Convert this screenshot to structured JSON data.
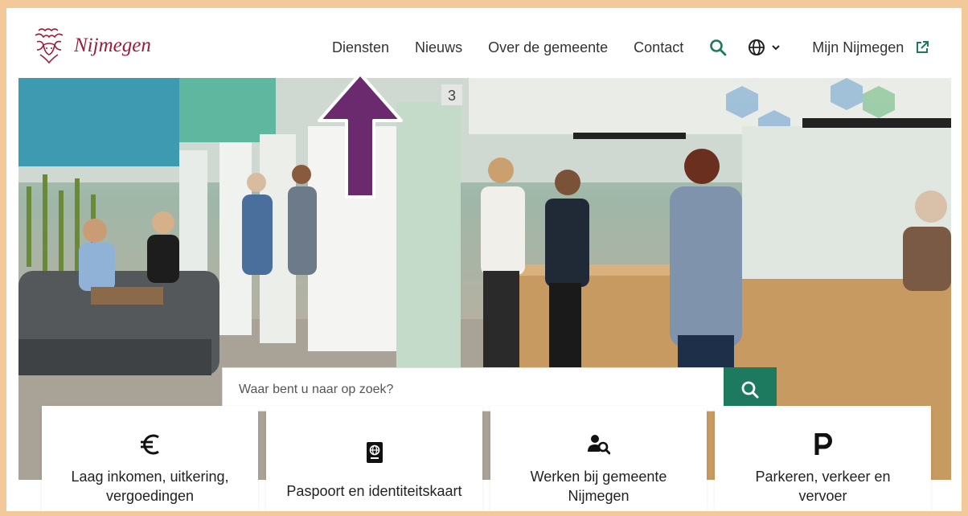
{
  "logo": {
    "text": "Nijmegen"
  },
  "nav": {
    "items": [
      {
        "label": "Diensten"
      },
      {
        "label": "Nieuws"
      },
      {
        "label": "Over de gemeente"
      },
      {
        "label": "Contact"
      }
    ],
    "mijn_label": "Mijn Nijmegen"
  },
  "search": {
    "placeholder": "Waar bent u naar op zoek?"
  },
  "cards": [
    {
      "label_line1": "Laag inkomen, uitkering,",
      "label_line2": "vergoedingen",
      "icon": "euro-icon"
    },
    {
      "label_line1": "Paspoort en identiteitskaart",
      "label_line2": "",
      "icon": "passport-icon"
    },
    {
      "label_line1": "Werken bij gemeente",
      "label_line2": "Nijmegen",
      "icon": "job-search-icon"
    },
    {
      "label_line1": "Parkeren, verkeer en",
      "label_line2": "vervoer",
      "icon": "parking-icon"
    }
  ],
  "hero": {
    "counter_number": "3"
  },
  "colors": {
    "brand": "#9c1c3a",
    "accent": "#1d7a5f",
    "arrow": "#6b2a6e",
    "frame": "#f3c99a"
  }
}
